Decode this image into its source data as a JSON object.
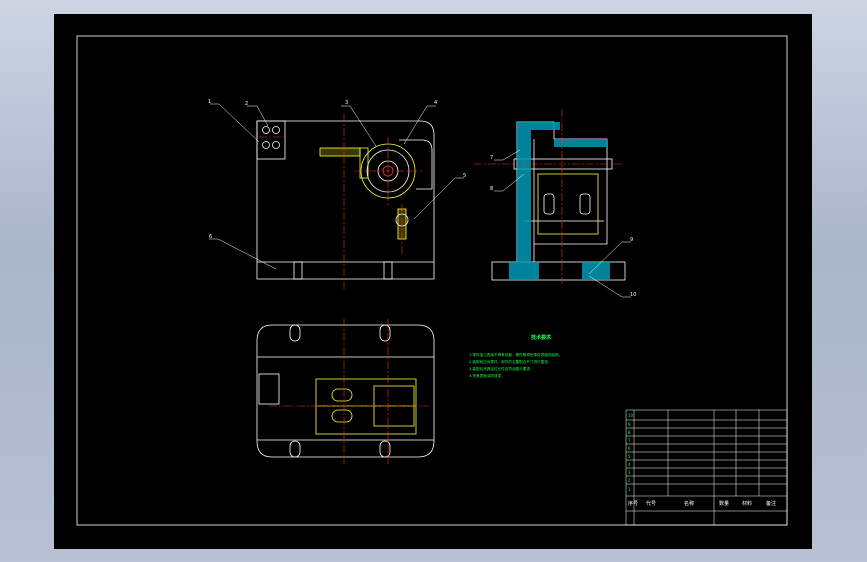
{
  "app": {
    "background": "#000000",
    "line_color": "#ffffff",
    "center_line": "#ff2a2a",
    "hidden_line": "#ffff33",
    "text_color": "#19ff4c"
  },
  "balloons": {
    "front_view": [
      "1",
      "2",
      "3",
      "4",
      "5",
      "6"
    ],
    "side_view": [
      "7",
      "8",
      "9",
      "10"
    ]
  },
  "technical_requirements": {
    "title": "技术要求",
    "lines": [
      "1.零件加工表面不得有划痕、擦伤等损伤零件表面的缺陷。",
      "2.装配前应对零件、部件的主要配合尺寸进行复查。",
      "3.装配后夹具定位元件应符合图示要求。",
      "4.夹具表面涂防锈漆。"
    ]
  },
  "title_block": {
    "rows": [
      {
        "no": "10",
        "code": "",
        "name": "",
        "qty": "",
        "material": ""
      },
      {
        "no": "9",
        "code": "",
        "name": "",
        "qty": "",
        "material": ""
      },
      {
        "no": "8",
        "code": "",
        "name": "",
        "qty": "",
        "material": ""
      },
      {
        "no": "7",
        "code": "",
        "name": "",
        "qty": "",
        "material": ""
      },
      {
        "no": "6",
        "code": "",
        "name": "",
        "qty": "",
        "material": ""
      },
      {
        "no": "5",
        "code": "",
        "name": "",
        "qty": "",
        "material": ""
      },
      {
        "no": "4",
        "code": "",
        "name": "",
        "qty": "",
        "material": ""
      },
      {
        "no": "3",
        "code": "",
        "name": "",
        "qty": "",
        "material": ""
      },
      {
        "no": "2",
        "code": "",
        "name": "",
        "qty": "",
        "material": ""
      },
      {
        "no": "1",
        "code": "",
        "name": "",
        "qty": "",
        "material": ""
      }
    ],
    "header": {
      "c1": "序号",
      "c2": "代号",
      "c3": "名称",
      "c4": "数量",
      "c5": "材料",
      "c6": "备注"
    },
    "bottom": {
      "c1": "",
      "c2": "",
      "c3": "",
      "c4": ""
    }
  }
}
